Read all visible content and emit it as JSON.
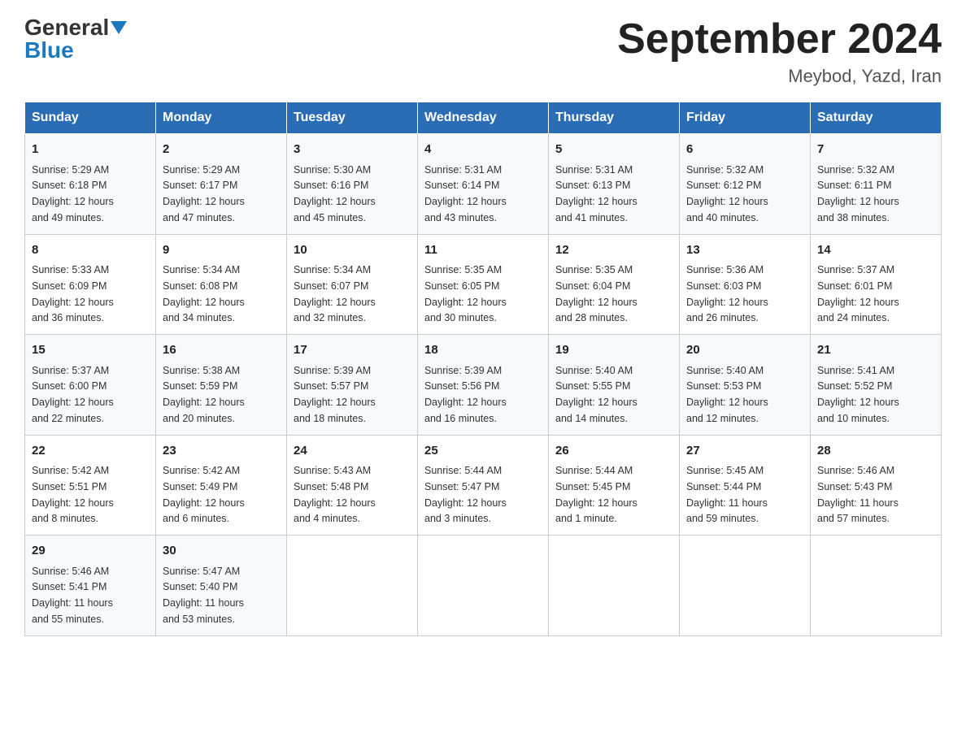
{
  "header": {
    "logo": {
      "general": "General",
      "blue": "Blue",
      "triangle": true
    },
    "title": "September 2024",
    "subtitle": "Meybod, Yazd, Iran"
  },
  "weekdays": [
    "Sunday",
    "Monday",
    "Tuesday",
    "Wednesday",
    "Thursday",
    "Friday",
    "Saturday"
  ],
  "weeks": [
    [
      {
        "day": "1",
        "sunrise": "5:29 AM",
        "sunset": "6:18 PM",
        "daylight": "12 hours and 49 minutes."
      },
      {
        "day": "2",
        "sunrise": "5:29 AM",
        "sunset": "6:17 PM",
        "daylight": "12 hours and 47 minutes."
      },
      {
        "day": "3",
        "sunrise": "5:30 AM",
        "sunset": "6:16 PM",
        "daylight": "12 hours and 45 minutes."
      },
      {
        "day": "4",
        "sunrise": "5:31 AM",
        "sunset": "6:14 PM",
        "daylight": "12 hours and 43 minutes."
      },
      {
        "day": "5",
        "sunrise": "5:31 AM",
        "sunset": "6:13 PM",
        "daylight": "12 hours and 41 minutes."
      },
      {
        "day": "6",
        "sunrise": "5:32 AM",
        "sunset": "6:12 PM",
        "daylight": "12 hours and 40 minutes."
      },
      {
        "day": "7",
        "sunrise": "5:32 AM",
        "sunset": "6:11 PM",
        "daylight": "12 hours and 38 minutes."
      }
    ],
    [
      {
        "day": "8",
        "sunrise": "5:33 AM",
        "sunset": "6:09 PM",
        "daylight": "12 hours and 36 minutes."
      },
      {
        "day": "9",
        "sunrise": "5:34 AM",
        "sunset": "6:08 PM",
        "daylight": "12 hours and 34 minutes."
      },
      {
        "day": "10",
        "sunrise": "5:34 AM",
        "sunset": "6:07 PM",
        "daylight": "12 hours and 32 minutes."
      },
      {
        "day": "11",
        "sunrise": "5:35 AM",
        "sunset": "6:05 PM",
        "daylight": "12 hours and 30 minutes."
      },
      {
        "day": "12",
        "sunrise": "5:35 AM",
        "sunset": "6:04 PM",
        "daylight": "12 hours and 28 minutes."
      },
      {
        "day": "13",
        "sunrise": "5:36 AM",
        "sunset": "6:03 PM",
        "daylight": "12 hours and 26 minutes."
      },
      {
        "day": "14",
        "sunrise": "5:37 AM",
        "sunset": "6:01 PM",
        "daylight": "12 hours and 24 minutes."
      }
    ],
    [
      {
        "day": "15",
        "sunrise": "5:37 AM",
        "sunset": "6:00 PM",
        "daylight": "12 hours and 22 minutes."
      },
      {
        "day": "16",
        "sunrise": "5:38 AM",
        "sunset": "5:59 PM",
        "daylight": "12 hours and 20 minutes."
      },
      {
        "day": "17",
        "sunrise": "5:39 AM",
        "sunset": "5:57 PM",
        "daylight": "12 hours and 18 minutes."
      },
      {
        "day": "18",
        "sunrise": "5:39 AM",
        "sunset": "5:56 PM",
        "daylight": "12 hours and 16 minutes."
      },
      {
        "day": "19",
        "sunrise": "5:40 AM",
        "sunset": "5:55 PM",
        "daylight": "12 hours and 14 minutes."
      },
      {
        "day": "20",
        "sunrise": "5:40 AM",
        "sunset": "5:53 PM",
        "daylight": "12 hours and 12 minutes."
      },
      {
        "day": "21",
        "sunrise": "5:41 AM",
        "sunset": "5:52 PM",
        "daylight": "12 hours and 10 minutes."
      }
    ],
    [
      {
        "day": "22",
        "sunrise": "5:42 AM",
        "sunset": "5:51 PM",
        "daylight": "12 hours and 8 minutes."
      },
      {
        "day": "23",
        "sunrise": "5:42 AM",
        "sunset": "5:49 PM",
        "daylight": "12 hours and 6 minutes."
      },
      {
        "day": "24",
        "sunrise": "5:43 AM",
        "sunset": "5:48 PM",
        "daylight": "12 hours and 4 minutes."
      },
      {
        "day": "25",
        "sunrise": "5:44 AM",
        "sunset": "5:47 PM",
        "daylight": "12 hours and 3 minutes."
      },
      {
        "day": "26",
        "sunrise": "5:44 AM",
        "sunset": "5:45 PM",
        "daylight": "12 hours and 1 minute."
      },
      {
        "day": "27",
        "sunrise": "5:45 AM",
        "sunset": "5:44 PM",
        "daylight": "11 hours and 59 minutes."
      },
      {
        "day": "28",
        "sunrise": "5:46 AM",
        "sunset": "5:43 PM",
        "daylight": "11 hours and 57 minutes."
      }
    ],
    [
      {
        "day": "29",
        "sunrise": "5:46 AM",
        "sunset": "5:41 PM",
        "daylight": "11 hours and 55 minutes."
      },
      {
        "day": "30",
        "sunrise": "5:47 AM",
        "sunset": "5:40 PM",
        "daylight": "11 hours and 53 minutes."
      },
      null,
      null,
      null,
      null,
      null
    ]
  ],
  "labels": {
    "sunrise": "Sunrise:",
    "sunset": "Sunset:",
    "daylight": "Daylight:"
  }
}
